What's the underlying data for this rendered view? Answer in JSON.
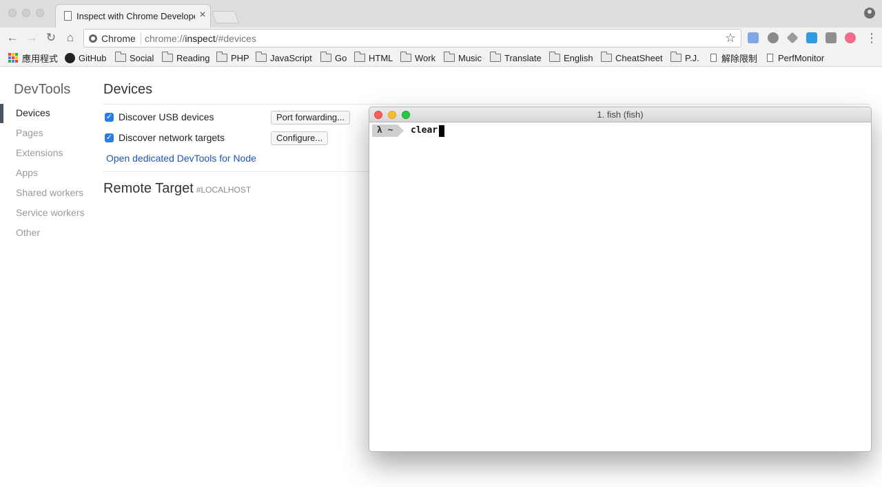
{
  "tab": {
    "title": "Inspect with Chrome Developer Tools",
    "close": "×"
  },
  "omnibox": {
    "site_label": "Chrome",
    "url_prefix": "chrome://",
    "url_host": "inspect",
    "url_hash": "/#devices"
  },
  "nav_buttons": {
    "back": "←",
    "forward": "→",
    "reload": "↻",
    "home": "⌂",
    "star": "☆",
    "menu": "⋮"
  },
  "bookmarks": [
    {
      "label": "應用程式",
      "icon": "apps-grid-icon"
    },
    {
      "label": "GitHub",
      "icon": "github-icon"
    },
    {
      "label": "Social",
      "icon": "folder-icon"
    },
    {
      "label": "Reading",
      "icon": "folder-icon"
    },
    {
      "label": "PHP",
      "icon": "folder-icon"
    },
    {
      "label": "JavaScript",
      "icon": "folder-icon"
    },
    {
      "label": "Go",
      "icon": "folder-icon"
    },
    {
      "label": "HTML",
      "icon": "folder-icon"
    },
    {
      "label": "Work",
      "icon": "folder-icon"
    },
    {
      "label": "Music",
      "icon": "folder-icon"
    },
    {
      "label": "Translate",
      "icon": "folder-icon"
    },
    {
      "label": "English",
      "icon": "folder-icon"
    },
    {
      "label": "CheatSheet",
      "icon": "folder-icon"
    },
    {
      "label": "P.J.",
      "icon": "folder-icon"
    },
    {
      "label": "解除限制",
      "icon": "page-icon"
    },
    {
      "label": "PerfMonitor",
      "icon": "page-icon"
    }
  ],
  "sidebar": {
    "title": "DevTools",
    "items": [
      {
        "label": "Devices",
        "active": true
      },
      {
        "label": "Pages"
      },
      {
        "label": "Extensions"
      },
      {
        "label": "Apps"
      },
      {
        "label": "Shared workers"
      },
      {
        "label": "Service workers"
      },
      {
        "label": "Other"
      }
    ]
  },
  "main": {
    "heading": "Devices",
    "usb_label": "Discover USB devices",
    "usb_checked": true,
    "port_forwarding_button": "Port forwarding...",
    "network_label": "Discover network targets",
    "network_checked": true,
    "configure_button": "Configure...",
    "node_link": "Open dedicated DevTools for Node",
    "remote_heading": "Remote Target",
    "remote_sub": "#LOCALHOST"
  },
  "terminal": {
    "title": "1. fish (fish)",
    "prompt": "λ ~",
    "command": "clear"
  },
  "colors": {
    "accent_blue": "#2b7de1",
    "link_blue": "#1f54b0",
    "close_red": "#fc5f57",
    "minimize_yellow": "#fdbc2e",
    "zoom_green": "#28c840"
  }
}
